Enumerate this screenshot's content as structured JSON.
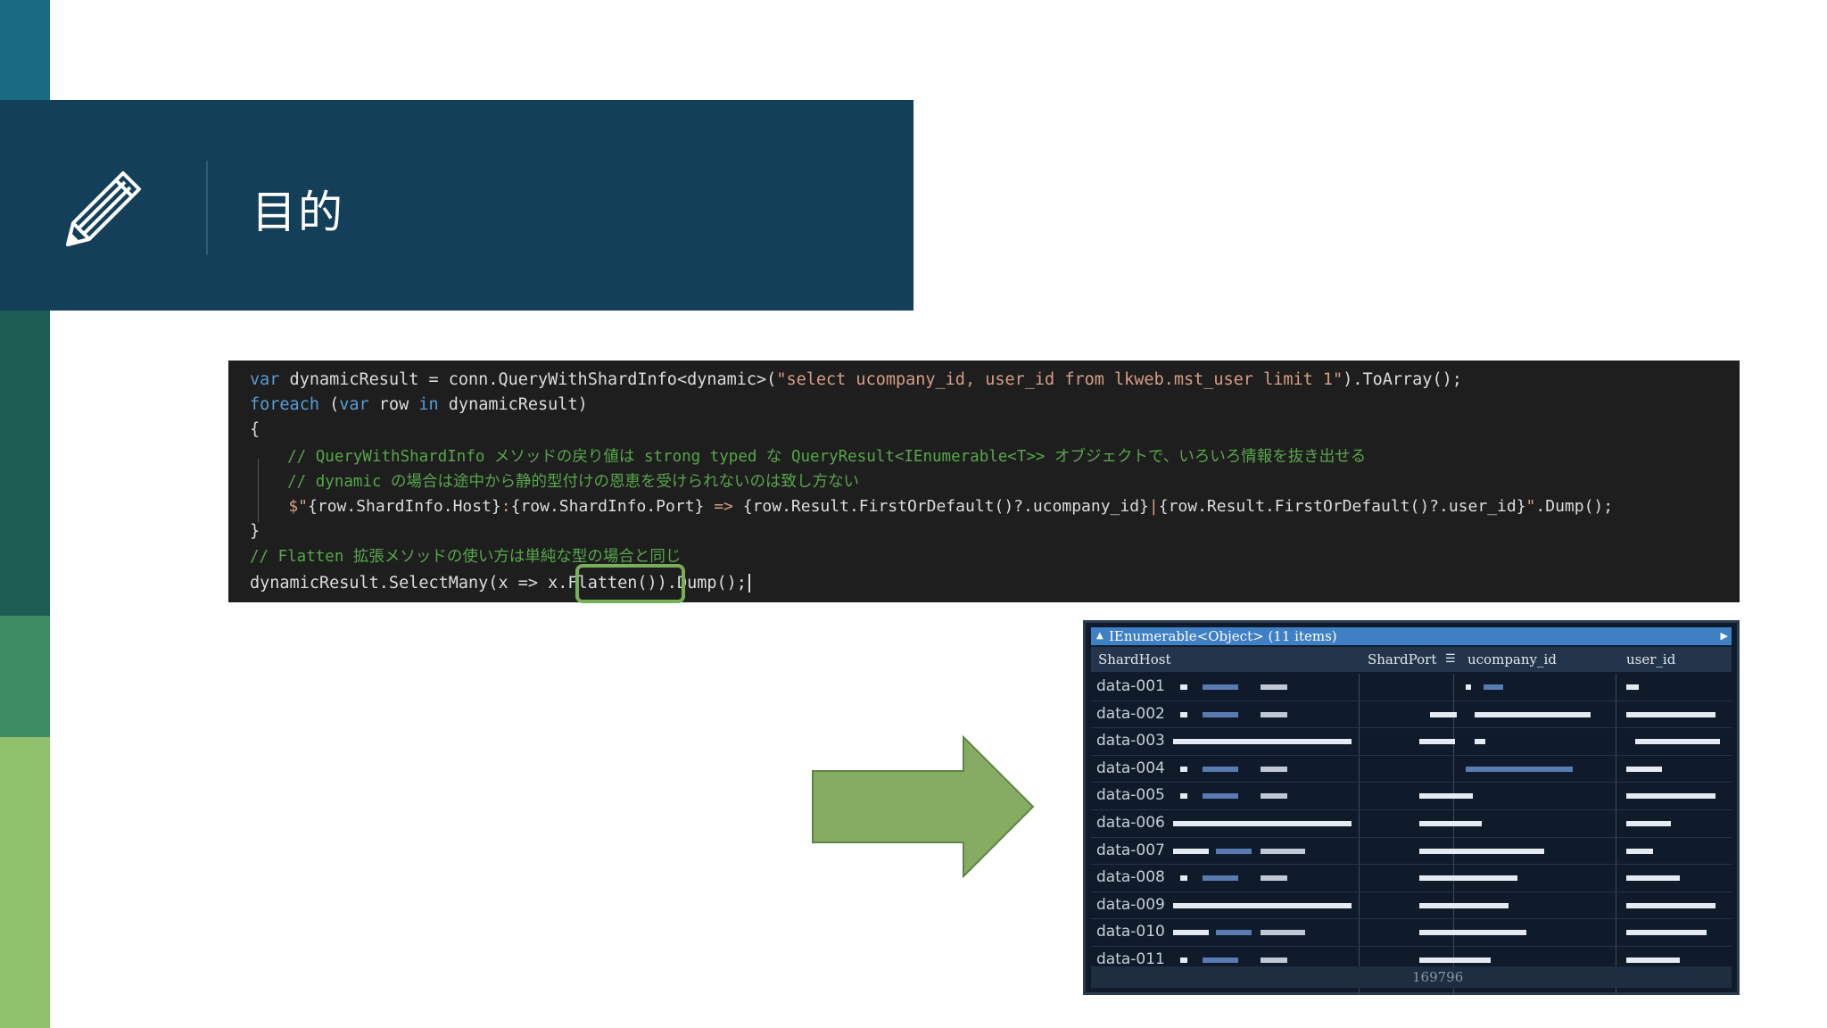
{
  "slide": {
    "title": "目的",
    "colors": {
      "banner": "#143f59",
      "accent_green": "#78b05a",
      "arrow": "#86ac64"
    }
  },
  "code": {
    "lines": {
      "l1": {
        "kw": "var",
        "a": " dynamicResult = conn.QueryWithShardInfo<dynamic>(",
        "str": "\"select ucompany_id, user_id from lkweb.mst_user limit 1\"",
        "b": ").ToArray();"
      },
      "l2": {
        "kw1": "foreach",
        "a": " (",
        "kw2": "var",
        "b": " row ",
        "kw3": "in",
        "c": " dynamicResult)"
      },
      "l3": "{",
      "l4": "    // QueryWithShardInfo メソッドの戻り値は strong typed な QueryResult<IEnumerable<T>> オブジェクトで、いろいろ情報を抜き出せる",
      "l5": "    // dynamic の場合は途中から静的型付けの恩恵を受けられないのは致し方ない",
      "l6": {
        "s": "    $\"",
        "a": "{row.ShardInfo.Host}",
        "b": ":",
        "c": "{row.ShardInfo.Port}",
        "d": " => ",
        "e": "{row.Result.FirstOrDefault()?.ucompany_id}",
        "f": "|",
        "g": "{row.Result.FirstOrDefault()?.user_id}",
        "h": "\"",
        "i": ".Dump();"
      },
      "l7": "}",
      "l8": "// Flatten 拡張メソッドの使い方は単純な型の場合と同じ",
      "l9": {
        "a": "dynamicResult.SelectMany(x => x.",
        "hl": "Flatten()",
        "b": ").Dump();"
      }
    }
  },
  "result": {
    "header": "IEnumerable<Object> (11 items)",
    "columns": [
      "ShardHost",
      "ShardPort",
      "ucompany_id",
      "user_id"
    ],
    "rows": [
      "data-001",
      "data-002",
      "data-003",
      "data-004",
      "data-005",
      "data-006",
      "data-007",
      "data-008",
      "data-009",
      "data-010",
      "data-011"
    ],
    "total": "169796",
    "icons": {
      "collapse": "triangle-up-icon",
      "expand": "triangle-right-icon",
      "sort": "sort-lines-icon"
    }
  }
}
